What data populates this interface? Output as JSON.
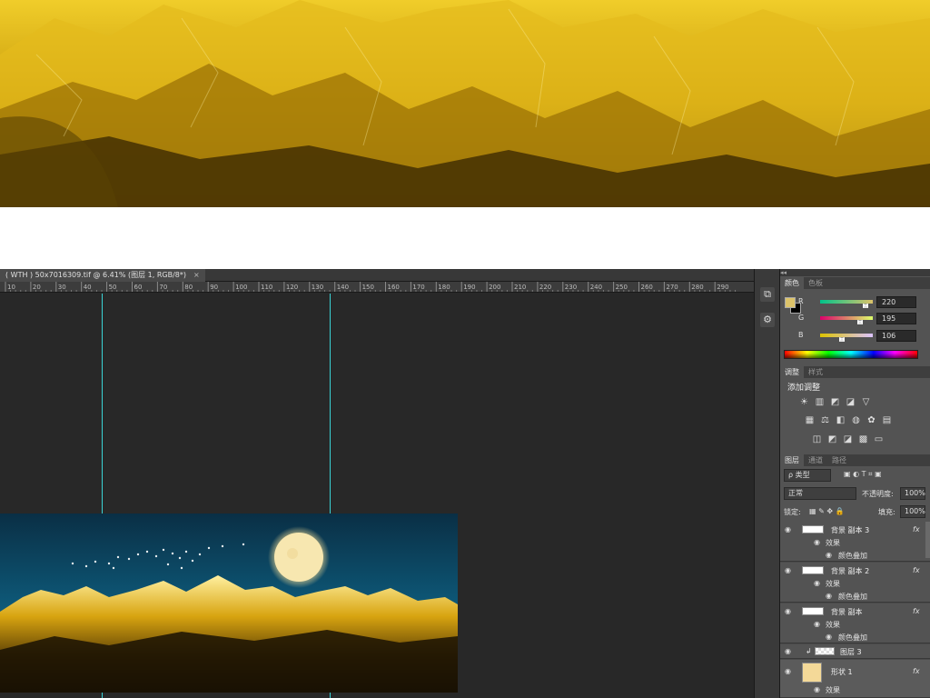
{
  "document": {
    "tab_title": "( WTH ) 50x7016309.tif @ 6.41% (图层 1, RGB/8*)",
    "close_glyph": "×"
  },
  "ruler": {
    "ticks": [
      "10",
      "20",
      "30",
      "40",
      "50",
      "60",
      "70",
      "80",
      "90",
      "100",
      "110",
      "120",
      "130",
      "140",
      "150",
      "160",
      "170",
      "180",
      "190",
      "200",
      "210",
      "220",
      "230",
      "240",
      "250",
      "260",
      "270",
      "280",
      "290"
    ]
  },
  "panels": {
    "collapse_glyph": "◂◂",
    "color": {
      "tabs": [
        "颜色",
        "色板"
      ],
      "fg_color": "#dcc36a",
      "bg_color": "#000000",
      "channels": [
        {
          "label": "R",
          "value": "220",
          "fraction": 0.86
        },
        {
          "label": "G",
          "value": "195",
          "fraction": 0.76
        },
        {
          "label": "B",
          "value": "106",
          "fraction": 0.42
        }
      ]
    },
    "adjustments": {
      "tabs": [
        "调整",
        "样式"
      ],
      "title": "添加调整",
      "row1": [
        "sun-icon",
        "levels-icon",
        "curves-icon",
        "exposure-icon",
        "triangle-icon"
      ],
      "row2": [
        "vibrance-icon",
        "balance-icon",
        "bw-icon",
        "photo-filter-icon",
        "channel-mixer-icon",
        "lookup-icon"
      ],
      "row3": [
        "invert-icon",
        "posterize-icon",
        "threshold-icon",
        "selective-color-icon",
        "gradient-map-icon"
      ]
    },
    "layers": {
      "tabs": [
        "图层",
        "通道",
        "路径"
      ],
      "filter_label": "ρ 类型",
      "blend_mode": "正常",
      "opacity_label": "不透明度:",
      "opacity_value": "100%",
      "lock_label": "锁定:",
      "fill_label": "填充:",
      "fill_value": "100%",
      "items": [
        {
          "name": "背景 副本 3",
          "fx": "fx",
          "effect": "效果",
          "sub": "颜色叠加"
        },
        {
          "name": "背景 副本 2",
          "fx": "fx",
          "effect": "效果",
          "sub": "颜色叠加"
        },
        {
          "name": "背景 副本",
          "fx": "fx",
          "effect": "效果",
          "sub": "颜色叠加"
        },
        {
          "name": "图层 3"
        },
        {
          "name": "形状 1",
          "fx": "fx",
          "effect": "效果"
        }
      ]
    }
  },
  "colors": {
    "accent_gold": "#d6ab0c",
    "guide": "#3ad3d6",
    "sky": "#0b4d6a"
  }
}
